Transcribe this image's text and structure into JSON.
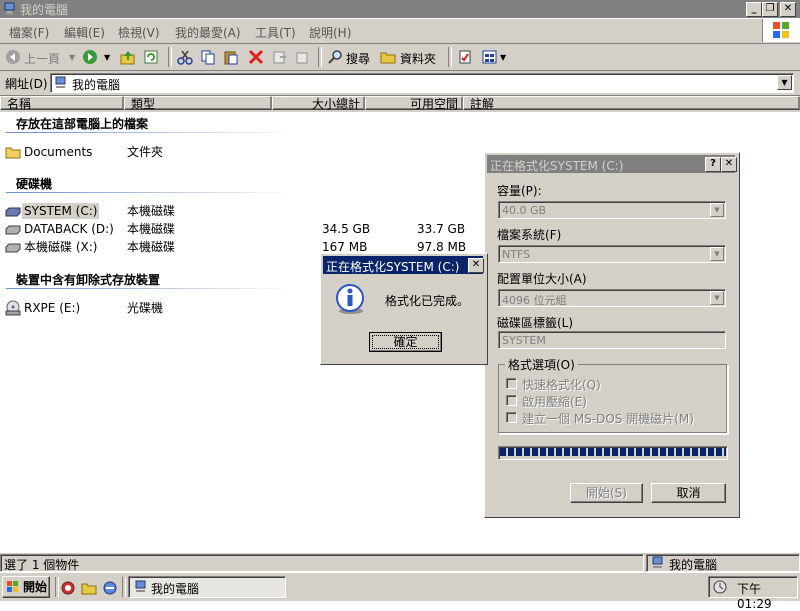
{
  "window": {
    "title": "我的電腦"
  },
  "menu": [
    "檔案(F)",
    "編輯(E)",
    "檢視(V)",
    "我的最愛(A)",
    "工具(T)",
    "說明(H)"
  ],
  "toolbar": {
    "back": "上一頁",
    "search": "搜尋",
    "folders": "資料夾"
  },
  "address": {
    "label": "網址(D)",
    "value": "我的電腦"
  },
  "columns": [
    "名稱",
    "類型",
    "大小總計",
    "可用空間",
    "註解"
  ],
  "groups": {
    "files": "存放在這部電腦上的檔案",
    "hdd": "硬碟機",
    "removable": "裝置中含有卸除式存放裝置"
  },
  "items": {
    "documents": {
      "name": "Documents",
      "type": "文件夾"
    },
    "system": {
      "name": "SYSTEM (C:)",
      "type": "本機磁碟"
    },
    "databack": {
      "name": "DATABACK (D:)",
      "type": "本機磁碟",
      "total": "34.5 GB",
      "free": "33.7 GB"
    },
    "localx": {
      "name": "本機磁碟 (X:)",
      "type": "本機磁碟",
      "total": "167 MB",
      "free": "97.8 MB"
    },
    "rxpe": {
      "name": "RXPE (E:)",
      "type": "光碟機"
    }
  },
  "status": {
    "left": "選了 1 個物件",
    "right": "我的電腦"
  },
  "taskbar": {
    "start": "開始",
    "task": "我的電腦",
    "clock": "下午 01:29"
  },
  "format_dialog": {
    "title": "正在格式化SYSTEM (C:)",
    "capacity_label": "容量(P):",
    "capacity_value": "40.0 GB",
    "fs_label": "檔案系統(F)",
    "fs_value": "NTFS",
    "alloc_label": "配置單位大小(A)",
    "alloc_value": "4096 位元組",
    "vol_label": "磁碟區標籤(L)",
    "vol_value": "SYSTEM",
    "options_label": "格式選項(O)",
    "opt_quick": "快速格式化(Q)",
    "opt_compress": "啟用壓縮(E)",
    "opt_msdos": "建立一個 MS-DOS 開機磁片(M)",
    "progress": 1.0,
    "start_btn": "開始(S)",
    "cancel_btn": "取消"
  },
  "message_box": {
    "title": "正在格式化SYSTEM (C:)",
    "text": "格式化已完成。",
    "ok": "確定"
  }
}
